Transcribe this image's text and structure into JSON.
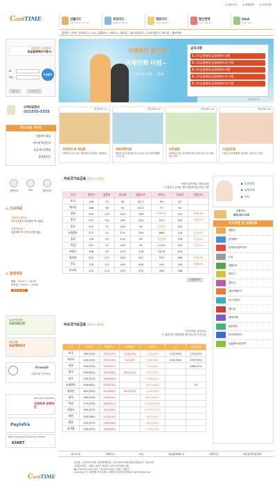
{
  "logo": {
    "prefix": "C",
    "middle": "ard",
    "suffix": "TIME"
  },
  "topnav": [
    "장바구니",
    "회원정보",
    "주문조회"
  ],
  "mainnav": [
    {
      "label": "선불카드",
      "sub": "편리한 온라인 선불 카드"
    },
    {
      "label": "로밍카드",
      "sub": "해외에서 편리하게"
    },
    {
      "label": "제휴카드",
      "sub": "기업과 제휴카드"
    },
    {
      "label": "할인판매",
      "sub": "다양한 상품 할인"
    },
    {
      "label": "Q&A",
      "sub": "궁금한 사항"
    }
  ],
  "subnav": "플랜카 | 온세 | 온처리나 | ICN | 엠플러스 | 에이스 | 클라임 | 세이브플러스 | 아시아넘어 | 레드빛 | 엠에이페",
  "login": {
    "title_small": "대체없는 요금결제!",
    "title": "요금결제헤드이용서",
    "id_label": "ID",
    "pw_label": "PW",
    "button": "Login",
    "join": "회원가입",
    "find": "ID/PW 찾기"
  },
  "customer": {
    "label": "고객상담센터",
    "phone": "(02)555-5555"
  },
  "guide": {
    "title": "카드사용 가이드",
    "items": [
      "선불카드생성",
      "카드별 특징안내",
      "요금카드선택법",
      "휴대폰로밍"
    ]
  },
  "quick_icons": [
    "이용안내",
    "FAQ",
    "충전안내"
  ],
  "new_order": {
    "title": "신규주문",
    "lines": [
      {
        "head": "신용카드결제시",
        "body": "24시간내내 요금결과 즉시발송"
      },
      {
        "head": "무통장입금시",
        "body": "입금확인 후 근무시간중 발송"
      }
    ]
  },
  "hours": {
    "title": "충전주문",
    "weekday_label": "평일",
    "weekday": "09:00 ~ 19:00",
    "sat_label": "토요일",
    "sat": "09:00 ~ 13:00",
    "closed": "일요일 휴무"
  },
  "left_banners": [
    {
      "title": "요금상담신청",
      "sub": "요금관리센터"
    },
    {
      "title": "입금계좌안내",
      "sub": "카드주문"
    },
    {
      "title": "Firewall",
      "sub": "요정자로 안전하게"
    },
    {
      "title": "128비트 완벽보안",
      "sub": "Security System"
    },
    {
      "title": "PayInfra",
      "sub": "Total Payment Solution Leader"
    },
    {
      "title": "KSNET",
      "sub": ""
    }
  ],
  "hero": {
    "line1": "이제부터 즐기자!",
    "line2": "국제전화 타임~",
    "line3": "편리한 세계 ... 통화"
  },
  "notice": {
    "title": "공지사항",
    "items": [
      "[요금결제]요금결제헤드대행",
      "[요금결제]요금결제헤드서 이용",
      "[요금결제]요금결제헤드대행",
      "[요금결제]요금결제헤드서 이용",
      "[요금결제]요금결제헤드서 이용"
    ],
    "more": "[자보공지]"
  },
  "cards": [
    {
      "badge": "추천카드 01",
      "title": "가족친지 & 애인용",
      "desc": "가족이나 친지 또는 애인에게 자주하는 사람에게..",
      "color": "#e9c98f"
    },
    {
      "badge": "추천카드 02",
      "title": "해외여행자용",
      "desc": "해외로 자주 출장을 다니시거나 자주 해외여행을 가시는 분",
      "color": "#b8d9e8"
    },
    {
      "badge": "추천카드 03",
      "title": "유학생용",
      "desc": "유학하고 있는 자녀에게 또는 외국으로 자주 연락하는 경우",
      "color": "#d6e9c0"
    },
    {
      "badge": "추천카드 04",
      "title": "기업업무용",
      "desc": "사업상 국제 통화를 자주하는 개인이나 기업",
      "color": "#f3d4c0"
    }
  ],
  "table1": {
    "title": "주요국가요금표",
    "title_note": "(한국 → 외국)",
    "note1": "*해외 일반전화 기준요금표",
    "note2": "*) 괄호안 금액은 핸드폰통화 발신요금 기준",
    "headers": [
      "국가",
      "세이브",
      "플랜카",
      "아시아",
      "엠플러스",
      "에이스",
      "온세카",
      "전용카드"
    ],
    "rows": [
      [
        "미국",
        "108",
        "75",
        "99",
        "82.5",
        "99",
        "87",
        ""
      ],
      [
        "캐나다",
        "186",
        "76",
        "99",
        "82.5",
        "77",
        "91",
        ""
      ],
      [
        "일본",
        "232",
        "180",
        "149",
        "105",
        "무선132",
        "112",
        "온세182"
      ],
      [
        "중국",
        "437",
        "380",
        "499",
        "420",
        "523",
        "420",
        "니카470"
      ],
      [
        "호주",
        "241",
        "95",
        "149",
        "90",
        "무선93",
        "122",
        ""
      ],
      [
        "뉴질랜드",
        "277",
        "94",
        "119",
        "100",
        "868",
        "124",
        "무선127"
      ],
      [
        "영국",
        "199",
        "88",
        "119",
        "90",
        "무선93",
        "129",
        "무선125"
      ],
      [
        "독일",
        "157",
        "99",
        "149",
        "95",
        "1224",
        "129",
        "무선144"
      ],
      [
        "프랑스",
        "186",
        "98",
        "119",
        "116",
        "1224",
        "124",
        ""
      ],
      [
        "필리핀",
        "251",
        "231",
        "249",
        "297",
        "233",
        "266",
        "온세255"
      ],
      [
        "인도",
        "175",
        "192",
        "199",
        "429",
        "194",
        "340",
        "온세238"
      ],
      [
        "러시아",
        "251",
        "208",
        "199",
        "374",
        "390",
        "348",
        ""
      ]
    ],
    "more": "자세히보기"
  },
  "table2": {
    "title": "주요국가요금표",
    "title_note": "(외국 → 한국)",
    "note1": "*VAT포함, 분당요금",
    "note2": "*) 괄호안은 통화품질 핸드폰요금 수신요금",
    "headers": [
      "국가",
      "데이콤",
      "엠피어나",
      "온세월드",
      "세이브",
      "KT",
      "1원국번호"
    ],
    "rows": [
      [
        "미국",
        "160(245)",
        "190(270)",
        "100(226)",
        "124(187)",
        "172(300)",
        "125(225)"
      ],
      [
        "캐나다",
        "145(225)",
        "150(230)",
        "74(143)",
        "118(184)",
        "240(350)",
        "250(390)"
      ],
      [
        "일본",
        "350(525)",
        "430(510)",
        "",
        "99(195)",
        "",
        "268(333)"
      ],
      [
        "중국",
        "595(691)",
        "500(580)",
        "632(532)",
        "437(477)",
        "",
        ""
      ],
      [
        "호주",
        "225(315)",
        "180(260)",
        "",
        "159(220)",
        "",
        ""
      ],
      [
        "뉴질랜드",
        "595(691)",
        "450(530)",
        "",
        "957(1061)",
        "",
        "75"
      ],
      [
        "필리핀",
        "461(563)",
        "610(690)",
        "400(490)",
        "430(545)",
        "",
        ""
      ],
      [
        "영국",
        "160(245)",
        "200(240)",
        "",
        "947(1051)",
        "",
        ""
      ],
      [
        "독일",
        "175(255)",
        "180(210)",
        "",
        "1180(1284)",
        "",
        ""
      ],
      [
        "프랑스",
        "365(475)",
        "310(380)",
        "",
        "1151(1255)",
        "",
        ""
      ],
      [
        "대만",
        "295(385)",
        "450(530)",
        "",
        "857(961)",
        "",
        ""
      ],
      [
        "홍콩",
        "225(315)",
        "180(260)",
        "",
        "852(956)",
        "",
        ""
      ],
      [
        "싱가폴",
        "225(315)",
        "180(260)",
        "",
        "157(219)",
        "",
        ""
      ]
    ],
    "more": "자세히보기"
  },
  "right": {
    "tel_title": "국가번호",
    "tel_sub": "상세조회",
    "tel_btn2": "시차",
    "card_pay": {
      "title": "신용카드",
      "sub": "결제서비스조회"
    },
    "cardlist_title": "카드주문 및 상세내용",
    "cards": [
      {
        "name": "클럽카",
        "color": "#f6a84a"
      },
      {
        "name": "온세월드",
        "color": "#4a8fd8"
      },
      {
        "name": "온세아이롱포인트",
        "color": "#e94a3a"
      },
      {
        "name": "ICN",
        "color": "#9a9a9a"
      },
      {
        "name": "엠플러스",
        "color": "#5aa34a"
      },
      {
        "name": "에이스",
        "color": "#d9c03a"
      },
      {
        "name": "클라임",
        "color": "#c05ab0"
      },
      {
        "name": "세이브플러스",
        "color": "#f0783a"
      },
      {
        "name": "아시아넘어",
        "color": "#3ab0c0"
      },
      {
        "name": "레드빛",
        "color": "#d83a3a"
      },
      {
        "name": "엠에이페",
        "color": "#7a5ad8"
      },
      {
        "name": "밀양에이",
        "color": "#4ab07a"
      },
      {
        "name": "미국로밍카드",
        "color": "#3a6ad8"
      },
      {
        "name": "뉴질랜드로밍카드",
        "color": "#8ac03a"
      }
    ]
  },
  "footer": {
    "nav": [
      "회사소개",
      "이용안내",
      "FAQ",
      "요금결제헤드서",
      "이용약관",
      "개인정보보호정책"
    ],
    "lines": [
      "상호명 : (주)아이디어앰 사업자등록번호 : 215-86-20068 통신판매업신고 : 제0408",
      "사업장소재지 : 서울시 송파구 석촌동 21번지 금익빌딩 4층",
      "☎ 02)0000-0000 FAX : 02)000-0000 | 대표 : 진병석",
      "Copyright © 국제전화 카드우체스 쇼핑몰 (주)아이디어앰 All rights Reserved."
    ]
  }
}
